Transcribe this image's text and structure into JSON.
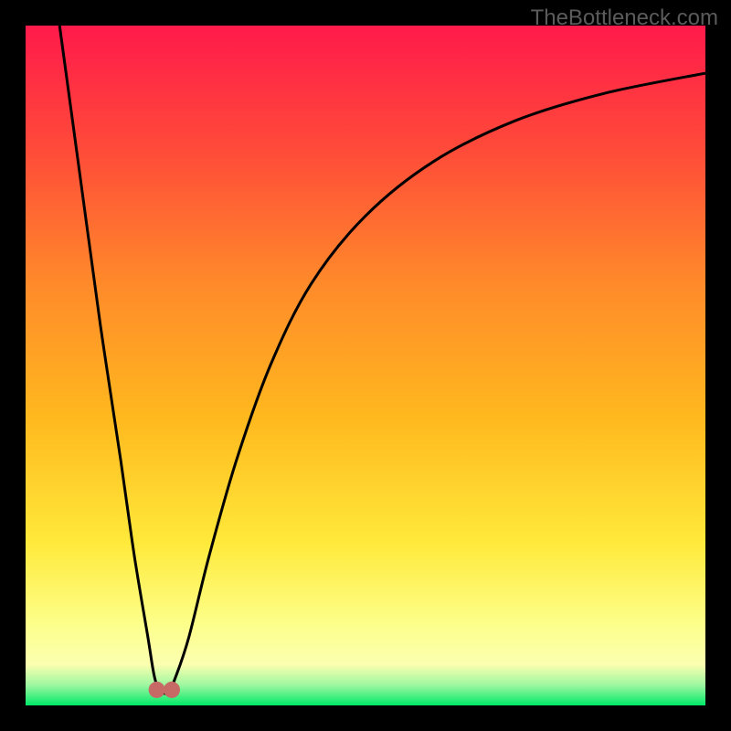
{
  "watermark": "TheBottleneck.com",
  "colors": {
    "top": "#ff1a4b",
    "upper_mid": "#ff6a2d",
    "mid": "#ffb91e",
    "lower_mid": "#ffe93a",
    "pale": "#fbffb0",
    "green": "#00e968",
    "curve": "#000000",
    "marker": "#c76a66",
    "frame": "#000000"
  },
  "chart_data": {
    "type": "line",
    "title": "",
    "xlabel": "",
    "ylabel": "",
    "xlim": [
      0,
      100
    ],
    "ylim": [
      0,
      100
    ],
    "series": [
      {
        "name": "bottleneck-curve",
        "x": [
          5,
          8,
          11,
          14,
          16,
          18,
          19,
          20,
          21,
          22,
          24,
          27,
          31,
          36,
          42,
          50,
          60,
          72,
          85,
          100
        ],
        "y": [
          100,
          78,
          56,
          36,
          22,
          10,
          4,
          2,
          2,
          4,
          10,
          22,
          36,
          50,
          62,
          72,
          80,
          86,
          90,
          93
        ]
      }
    ],
    "markers": [
      {
        "name": "minimum-left",
        "x": 19.3,
        "y": 2.3
      },
      {
        "name": "minimum-right",
        "x": 21.5,
        "y": 2.3
      }
    ],
    "annotations": []
  }
}
